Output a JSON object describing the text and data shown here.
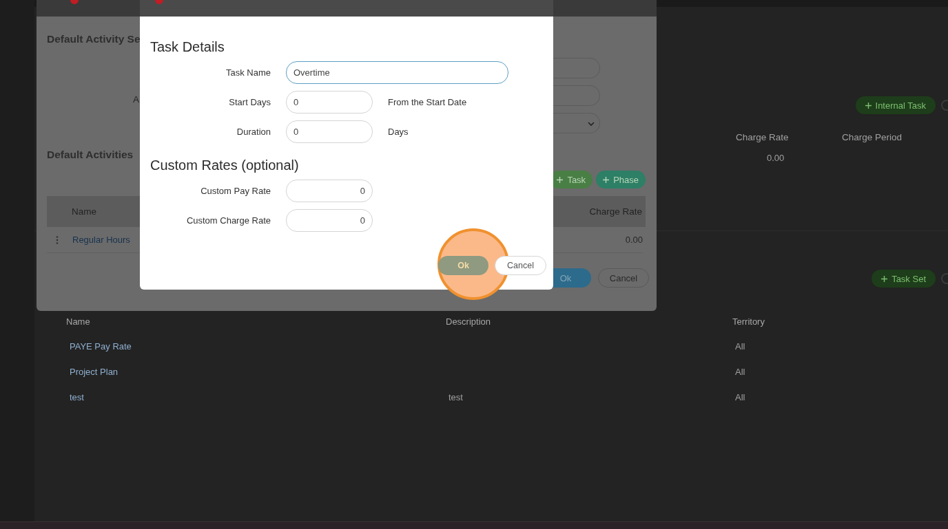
{
  "page": {
    "internal_task_button": "Internal Task",
    "charge_table": {
      "columns": [
        "Charge Rate",
        "Charge Period"
      ],
      "rows": [
        {
          "charge_rate": "0.00"
        }
      ]
    },
    "task_set_button": "Task Set",
    "task_sets_table": {
      "columns": [
        "Name",
        "Description",
        "Territory"
      ],
      "rows": [
        {
          "name": "PAYE Pay Rate",
          "territory": "All"
        },
        {
          "name": "Project Plan",
          "territory": "All"
        },
        {
          "name": "test",
          "description": "test",
          "territory": "All"
        }
      ]
    }
  },
  "settings_dialog": {
    "title": "Default Activity Se",
    "field_label": "A",
    "section_title": "Default Activities",
    "add_buttons": [
      {
        "label": "Task",
        "kind": "task"
      },
      {
        "label": "Phase",
        "kind": "phase"
      }
    ],
    "table": {
      "columns": [
        "Name",
        "Charge Rate"
      ],
      "rows": [
        {
          "name": "Regular Hours",
          "charge_rate": "0.00"
        }
      ]
    },
    "ok": "Ok",
    "cancel": "Cancel"
  },
  "task_dialog": {
    "sections": [
      {
        "title": "Task Details",
        "fields": [
          {
            "label": "Task Name",
            "value": "Overtime",
            "kind": "wide",
            "focused": true
          },
          {
            "label": "Start Days",
            "value": "0",
            "kind": "short",
            "focused": false,
            "suffix": "From the Start Date"
          },
          {
            "label": "Duration",
            "value": "0",
            "kind": "short",
            "focused": false,
            "suffix": "Days"
          }
        ]
      },
      {
        "title": "Custom Rates (optional)",
        "fields": [
          {
            "label": "Custom Pay Rate",
            "value": "0",
            "kind": "number",
            "focused": false
          },
          {
            "label": "Custom Charge Rate",
            "value": "0",
            "kind": "number",
            "focused": false
          }
        ]
      }
    ],
    "ok": "Ok",
    "cancel": "Cancel"
  }
}
